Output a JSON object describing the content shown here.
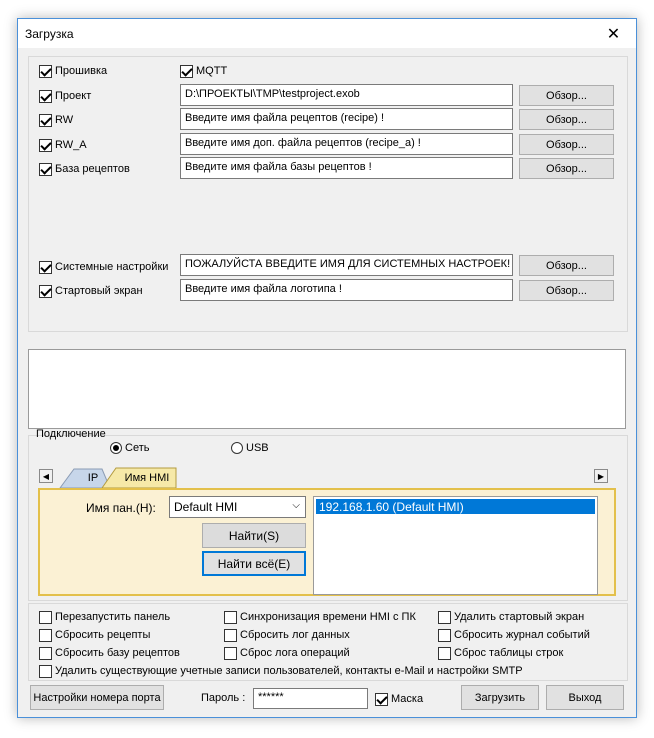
{
  "window": {
    "title": "Загрузка"
  },
  "top": {
    "firmware_label": "Прошивка",
    "mqtt_label": "MQTT",
    "rows": [
      {
        "label": "Проект",
        "value": "D:\\ПРОЕКТЫ\\TMP\\testproject.exob",
        "browse": "Обзор..."
      },
      {
        "label": "RW",
        "value": "Введите имя файла рецептов (recipe) !",
        "browse": "Обзор..."
      },
      {
        "label": "RW_A",
        "value": "Введите имя доп. файла рецептов (recipe_a) !",
        "browse": "Обзор..."
      },
      {
        "label": "База рецептов",
        "value": "Введите имя файла базы рецептов !",
        "browse": "Обзор..."
      },
      {
        "label": "Системные настройки",
        "value": "ПОЖАЛУЙСТА ВВЕДИТЕ ИМЯ ДЛЯ СИСТЕМНЫХ НАСТРОЕК!",
        "browse": "Обзор..."
      },
      {
        "label": "Стартовый экран",
        "value": "Введите имя файла логотипа !",
        "browse": "Обзор..."
      }
    ]
  },
  "connection": {
    "group_label": "Подключение",
    "radio_network": "Сеть",
    "radio_usb": "USB",
    "tab_ip": "IP",
    "tab_hmi": "Имя HMI",
    "panel_name_label": "Имя пан.(H):",
    "panel_name_value": "Default HMI",
    "find_button": "Найти(S)",
    "find_all_button": "Найти всё(E)",
    "list_items": [
      "192.168.1.60 (Default HMI)"
    ]
  },
  "options": [
    "Перезапустить панель",
    "Синхронизация времени HMI с ПК",
    "Удалить стартовый экран",
    "Сбросить рецепты",
    "Сбросить лог данных",
    "Сбросить журнал событий",
    "Сбросить базу рецептов",
    "Сброс лога операций",
    "Сброс таблицы строк",
    "Удалить существующие учетные записи пользователей, контакты e-Mail и настройки SMTP"
  ],
  "footer": {
    "port_button": "Настройки номера порта",
    "password_label": "Пароль :",
    "password_value": "******",
    "mask_label": "Маска",
    "upload_button": "Загрузить",
    "exit_button": "Выход"
  }
}
